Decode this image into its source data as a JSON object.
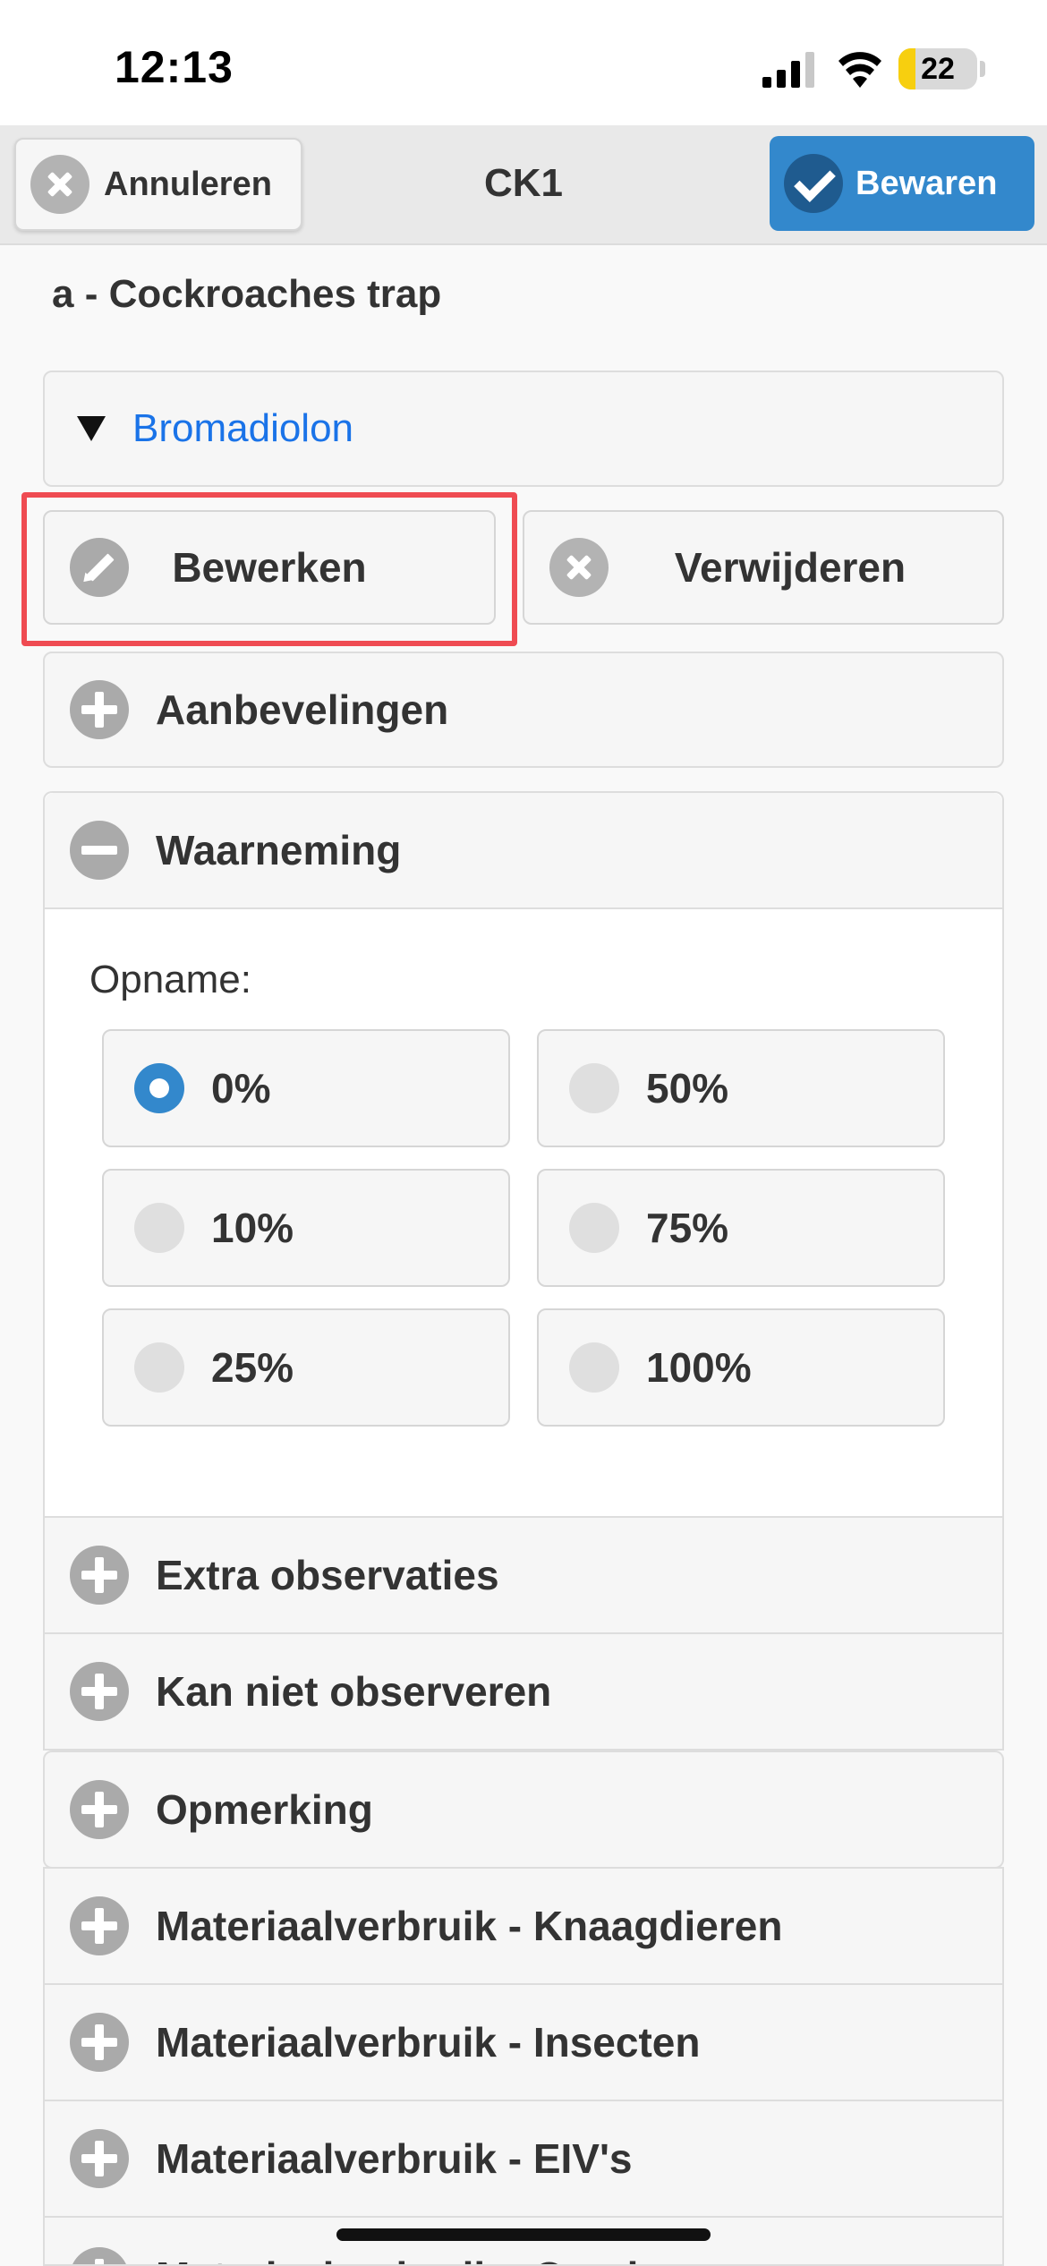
{
  "status_bar": {
    "time": "12:13",
    "battery": "22",
    "battery_level": 0.22
  },
  "header": {
    "cancel_label": "Annuleren",
    "title": "CK1",
    "save_label": "Bewaren",
    "save_color": "#3388cc"
  },
  "section_title": "a - Cockroaches trap",
  "product": {
    "label": "Bromadiolon",
    "link_color": "#1a73e8"
  },
  "actions": {
    "edit_label": "Bewerken",
    "delete_label": "Verwijderen",
    "highlight_color": "#ef4b52"
  },
  "aanbevelingen": {
    "label": "Aanbevelingen"
  },
  "waarneming": {
    "label": "Waarneming",
    "opname_label": "Opname:",
    "selected": "0%",
    "options": [
      "0%",
      "50%",
      "10%",
      "75%",
      "25%",
      "100%"
    ]
  },
  "sections": [
    {
      "label": "Extra observaties"
    },
    {
      "label": "Kan niet observeren"
    },
    {
      "label": "Opmerking"
    },
    {
      "label": "Materiaalverbruik - Knaagdieren"
    },
    {
      "label": "Materiaalverbruik - Insecten"
    },
    {
      "label": "Materiaalverbruik - EIV's"
    },
    {
      "label": "Materiaalverbruik - Overig"
    }
  ]
}
